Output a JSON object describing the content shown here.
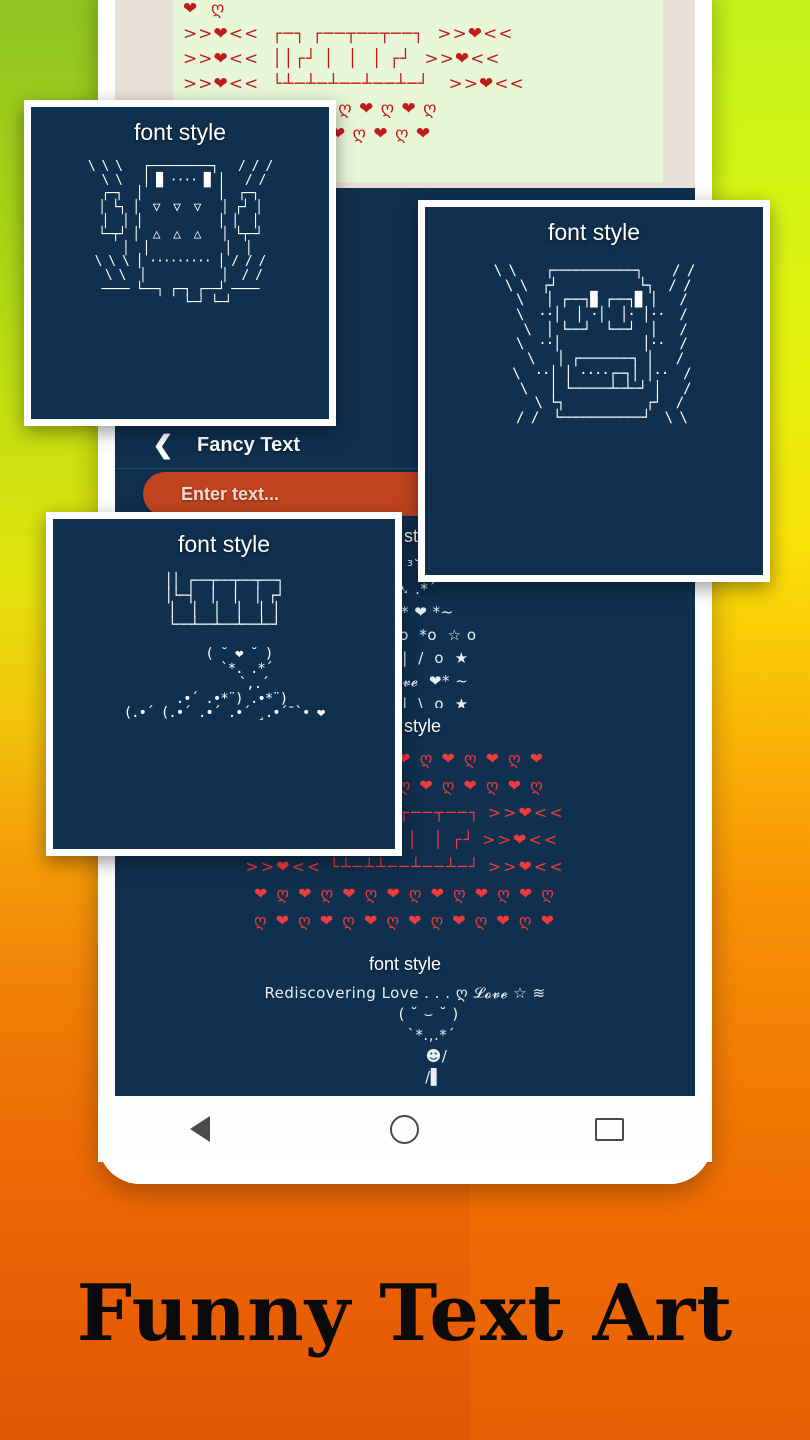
{
  "app": {
    "bottom_title": "Funny Text Art",
    "accent_orange": "#c0441f",
    "screen_navy": "#103050",
    "card_border": "#ffffff",
    "heart_red": "#ef3b3b"
  },
  "phone": {
    "appbar": {
      "back_icon": "chevron-left-icon",
      "title": "Fancy Text"
    },
    "search": {
      "placeholder": "Enter text...",
      "value": ""
    },
    "navbar": {
      "back": "back-triangle-icon",
      "home": "home-circle-icon",
      "recents": "recents-square-icon"
    },
    "wallpaper_card": {
      "art": "❤  ღ  ❤  ღ  ❤  ღ  ❤  ღ  ❤  ღ  ❤  ღ\n❤  ღ\n>>❤<<  ┌─┐ ┌──┬──┬──┐  >>❤<<\n>>❤<<  ││┌┘ │  │  │ ┌┘  >>❤<<\n>>❤<<  └┴─┴─┴──┴──┴─┘   >>❤<<\n ❤ ღ ❤ ღ ❤ ღ ❤ ღ ❤ ღ ❤ ღ\nღ ❤ ღ ❤ ღ ❤ ღ ❤ ღ ❤ ღ ❤"
    },
    "rows": [
      {
        "label": "font style",
        "art": "( ˘ ³˘)\n  ⁀➷ .*´\n ❤ *~* ❤ *~\n. . .o  ☆ o  *o  ☆ o\n..★o  \\  |  /  o  ★\n. *❤  𝓛𝓸𝓿𝓮  ❤* ~\n..★o  /  |  \\  o  ★"
      },
      {
        "label": "font style",
        "art": "❤ ღ ❤ ღ ❤ ღ ❤ ღ ❤ ღ ❤ ღ ❤\nღ ❤ ღ ❤ ღ ❤ ღ ❤ ღ ❤ ღ ❤ ღ\n>>❤<< ┌─┐┌──┬──┬──┐ >>❤<<\n>>❤<< ││┌┘│  │  │ ┌┘ >>❤<<\n>>❤<< └┴─┴┴──┴──┴─┘ >>❤<<\n❤ ღ ❤ ღ ❤ ღ ❤ ღ ❤ ღ ❤ ღ ❤ ღ\nღ ❤ ღ ❤ ღ ❤ ღ ❤ ღ ❤ ღ ❤ ღ ❤"
      },
      {
        "label": "font style",
        "art": "Rediscovering Love . . . ღ 𝓛𝓸𝓿𝓮 ☆ ≋\n         ( ˘ ⌣ ˘ )\n          `*.,.*´\n            ☻/\n           /▌"
      }
    ]
  },
  "floating_cards": [
    {
      "title": "font style",
      "art": "\\ \\ \\   ┌─────────┐   / / /\n \\ \\   │ ▉ ···· ▉ │   / /\n┌─┐  │           │  ┌─┐\n│ └┐ │  ▽  ▽  ▽   │ ┌┘ │\n│  │ │           │ │  │\n└─┬┘ │  △  △  △   │ └┬─┘\n  │  │           │  │\n\\ \\ \\ │ ········· │ / / /\n \\ \\  │           │  / /\n──── └──┐ ┌─┐ ┌──┘ ────\n        └─┘ └─┘"
    },
    {
      "title": "font style",
      "art": "\\ \\    ┌───────────┐    / /\n \\ \\  ┌┘           └┐  / /\n  \\   │ ┌──┐▉ ┌──┐▉ │   /\n  \\  ··│  │ ·│  │· │··  /\n   \\  │ └──┘  └──┘  │   /\n  \\  ··│           │··  /\n   \\   │ ┌───────┐ │   /\n  \\  ··│ │ ····┌─┐│ │··  /\n   \\   │ └─────┴─┴─┘ │   /\n    \\ └┐           ┌┘  /\n  / /  └───────────┘  \\ \\"
    },
    {
      "title": "font style",
      "art": "││ ┌──┬──┬──┬──┐\n│└─┤  │  │  │ ┌┘\n│  │  │  │  │ │\n└──┴──┴──┴──┴─┘\n\n    ( ˘ ❤ ˘ )\n      `*. .*´\n        `,.´\n  .•´ .•*¨) .•*¨)\n(.•´ (.•´ .•´ .•´ ¸.•´¯`• ❤"
    }
  ]
}
